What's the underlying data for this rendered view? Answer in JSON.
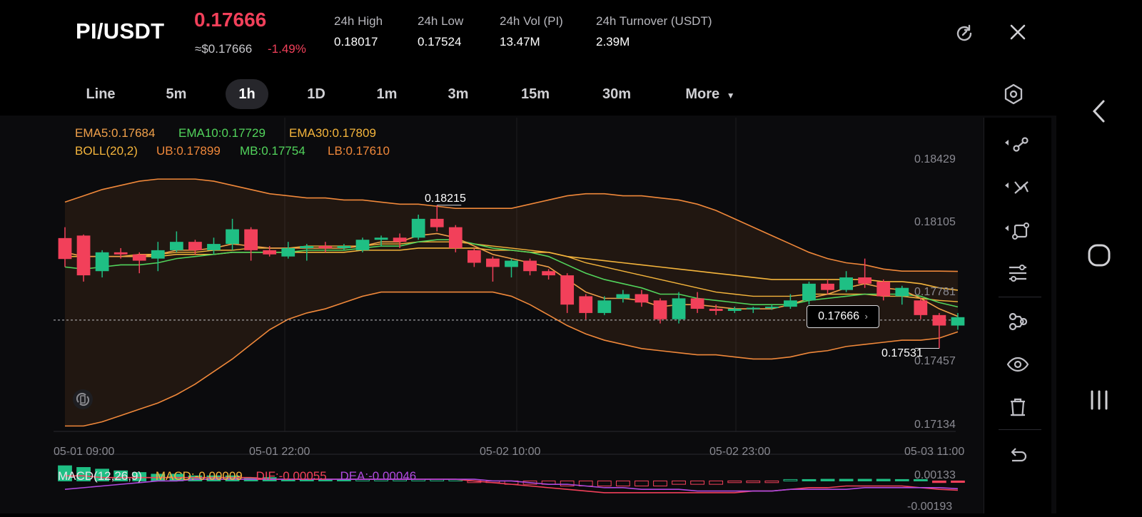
{
  "header": {
    "pair": "PI/USDT",
    "price": "0.17666",
    "approx": "≈$0.17666",
    "change": "-1.49%",
    "stats": [
      {
        "label": "24h   High",
        "value": "0.18017"
      },
      {
        "label": "24h   Low",
        "value": "0.17524"
      },
      {
        "label": "24h   Vol (PI)",
        "value": "13.47M"
      },
      {
        "label": "24h   Turnover (USDT)",
        "value": "2.39M"
      }
    ]
  },
  "tabs": [
    "Line",
    "5m",
    "1h",
    "1D",
    "1m",
    "3m",
    "15m",
    "30m",
    "More"
  ],
  "active_tab": "1h",
  "indicators": {
    "ema5": "EMA5:0.17684",
    "ema10": "EMA10:0.17729",
    "ema30": "EMA30:0.17809",
    "boll": "BOLL(20,2)",
    "ub": "UB:0.17899",
    "mb": "MB:0.17754",
    "lb": "LB:0.17610"
  },
  "price_axis": [
    "0.18429",
    "0.18105",
    "0.17781",
    "0.17457",
    "0.17134"
  ],
  "time_axis": [
    "05-01 09:00",
    "05-01 22:00",
    "05-02 10:00",
    "05-02 23:00",
    "05-03 11:00"
  ],
  "markers": {
    "high": "0.18215",
    "low": "0.17531",
    "current": "0.17666"
  },
  "macd": {
    "title": "MACD(12,26,9)",
    "macd": "MACD:-0.00009",
    "dif": "DIF:-0.00055",
    "dea": "DEA:-0.00046",
    "axis_top": "0.00133",
    "axis_bottom": "-0.00193"
  },
  "colors": {
    "up": "#1fbf84",
    "down": "#f2405a",
    "ema5": "#f0a04a",
    "ema10": "#52d45c",
    "ema30": "#f5b53c",
    "boll": "#f0883a",
    "dea": "#b04adf"
  },
  "chart_data": {
    "type": "candlestick",
    "ylim": [
      0.17134,
      0.18429
    ],
    "candles": [
      {
        "o": 0.18058,
        "c": 0.17958,
        "h": 0.1811,
        "l": 0.1792
      },
      {
        "o": 0.1807,
        "c": 0.1788,
        "h": 0.18075,
        "l": 0.1785
      },
      {
        "o": 0.179,
        "c": 0.1799,
        "h": 0.18,
        "l": 0.1787
      },
      {
        "o": 0.1799,
        "c": 0.1798,
        "h": 0.1801,
        "l": 0.1796
      },
      {
        "o": 0.1798,
        "c": 0.1795,
        "h": 0.1799,
        "l": 0.1789
      },
      {
        "o": 0.1796,
        "c": 0.18,
        "h": 0.1804,
        "l": 0.179
      },
      {
        "o": 0.18,
        "c": 0.1804,
        "h": 0.1809,
        "l": 0.1799
      },
      {
        "o": 0.1804,
        "c": 0.18,
        "h": 0.1805,
        "l": 0.1798
      },
      {
        "o": 0.18,
        "c": 0.1803,
        "h": 0.1806,
        "l": 0.1798
      },
      {
        "o": 0.1803,
        "c": 0.181,
        "h": 0.1815,
        "l": 0.18
      },
      {
        "o": 0.181,
        "c": 0.18,
        "h": 0.1811,
        "l": 0.1795
      },
      {
        "o": 0.18,
        "c": 0.1798,
        "h": 0.1802,
        "l": 0.1797
      },
      {
        "o": 0.1797,
        "c": 0.1801,
        "h": 0.1804,
        "l": 0.1796
      },
      {
        "o": 0.1801,
        "c": 0.1802,
        "h": 0.1803,
        "l": 0.1795
      },
      {
        "o": 0.1802,
        "c": 0.1801,
        "h": 0.1804,
        "l": 0.1799
      },
      {
        "o": 0.1801,
        "c": 0.1802,
        "h": 0.1803,
        "l": 0.18
      },
      {
        "o": 0.18,
        "c": 0.1805,
        "h": 0.1806,
        "l": 0.1799
      },
      {
        "o": 0.1805,
        "c": 0.1806,
        "h": 0.1807,
        "l": 0.1802
      },
      {
        "o": 0.1806,
        "c": 0.1804,
        "h": 0.1808,
        "l": 0.1801
      },
      {
        "o": 0.1806,
        "c": 0.1815,
        "h": 0.1817,
        "l": 0.1805
      },
      {
        "o": 0.1815,
        "c": 0.1811,
        "h": 0.18215,
        "l": 0.1809
      },
      {
        "o": 0.1811,
        "c": 0.1801,
        "h": 0.1812,
        "l": 0.1799
      },
      {
        "o": 0.18,
        "c": 0.1794,
        "h": 0.1801,
        "l": 0.1792
      },
      {
        "o": 0.1796,
        "c": 0.1792,
        "h": 0.1797,
        "l": 0.1785
      },
      {
        "o": 0.1792,
        "c": 0.1795,
        "h": 0.1796,
        "l": 0.1787
      },
      {
        "o": 0.1795,
        "c": 0.179,
        "h": 0.1796,
        "l": 0.1788
      },
      {
        "o": 0.179,
        "c": 0.1788,
        "h": 0.1791,
        "l": 0.1786
      },
      {
        "o": 0.1788,
        "c": 0.1774,
        "h": 0.1789,
        "l": 0.177
      },
      {
        "o": 0.1778,
        "c": 0.177,
        "h": 0.1779,
        "l": 0.1767
      },
      {
        "o": 0.177,
        "c": 0.1776,
        "h": 0.1778,
        "l": 0.1769
      },
      {
        "o": 0.1777,
        "c": 0.1779,
        "h": 0.1781,
        "l": 0.1775
      },
      {
        "o": 0.1779,
        "c": 0.1775,
        "h": 0.1781,
        "l": 0.1773
      },
      {
        "o": 0.1776,
        "c": 0.1767,
        "h": 0.1777,
        "l": 0.1765
      },
      {
        "o": 0.1767,
        "c": 0.1777,
        "h": 0.178,
        "l": 0.1765
      },
      {
        "o": 0.1777,
        "c": 0.1772,
        "h": 0.178,
        "l": 0.177
      },
      {
        "o": 0.1772,
        "c": 0.1771,
        "h": 0.1774,
        "l": 0.1769
      },
      {
        "o": 0.1771,
        "c": 0.1772,
        "h": 0.1773,
        "l": 0.177
      },
      {
        "o": 0.1772,
        "c": 0.17725,
        "h": 0.1773,
        "l": 0.177
      },
      {
        "o": 0.17725,
        "c": 0.1773,
        "h": 0.1774,
        "l": 0.17715
      },
      {
        "o": 0.1773,
        "c": 0.1776,
        "h": 0.1779,
        "l": 0.1772
      },
      {
        "o": 0.1776,
        "c": 0.1784,
        "h": 0.1785,
        "l": 0.1774
      },
      {
        "o": 0.1784,
        "c": 0.1781,
        "h": 0.1786,
        "l": 0.1779
      },
      {
        "o": 0.1781,
        "c": 0.1787,
        "h": 0.179,
        "l": 0.178
      },
      {
        "o": 0.1787,
        "c": 0.1784,
        "h": 0.1796,
        "l": 0.1782
      },
      {
        "o": 0.1785,
        "c": 0.1778,
        "h": 0.1786,
        "l": 0.1776
      },
      {
        "o": 0.1778,
        "c": 0.1782,
        "h": 0.1783,
        "l": 0.1774
      },
      {
        "o": 0.1776,
        "c": 0.1769,
        "h": 0.1777,
        "l": 0.1767
      },
      {
        "o": 0.1769,
        "c": 0.1764,
        "h": 0.177,
        "l": 0.17531
      },
      {
        "o": 0.1764,
        "c": 0.1768,
        "h": 0.177,
        "l": 0.1762
      }
    ],
    "ema5": [
      0.1799,
      0.1797,
      0.1797,
      0.1797,
      0.1797,
      0.1798,
      0.18,
      0.18,
      0.1801,
      0.1803,
      0.1802,
      0.1801,
      0.1801,
      0.1801,
      0.1801,
      0.1801,
      0.1802,
      0.1804,
      0.1804,
      0.1807,
      0.1808,
      0.1806,
      0.1802,
      0.1798,
      0.1796,
      0.1794,
      0.1792,
      0.1786,
      0.178,
      0.1777,
      0.1777,
      0.1776,
      0.1773,
      0.1774,
      0.1774,
      0.1773,
      0.1772,
      0.1772,
      0.1772,
      0.1774,
      0.1777,
      0.1779,
      0.1782,
      0.1784,
      0.1782,
      0.1781,
      0.1777,
      0.1772,
      0.17684
    ],
    "ema10": [
      0.1792,
      0.1791,
      0.1792,
      0.1793,
      0.1793,
      0.1794,
      0.1796,
      0.1797,
      0.1798,
      0.1799,
      0.1799,
      0.1799,
      0.1799,
      0.18,
      0.18,
      0.18,
      0.1801,
      0.1802,
      0.1802,
      0.1804,
      0.1805,
      0.1805,
      0.1803,
      0.1801,
      0.18,
      0.1799,
      0.1797,
      0.1793,
      0.1789,
      0.1786,
      0.1784,
      0.1782,
      0.1779,
      0.1779,
      0.1777,
      0.1776,
      0.1775,
      0.1774,
      0.1774,
      0.1774,
      0.1776,
      0.1777,
      0.1778,
      0.1779,
      0.1779,
      0.1779,
      0.1778,
      0.1775,
      0.17729
    ],
    "ema30": [
      0.1797,
      0.1797,
      0.1797,
      0.1797,
      0.1797,
      0.1797,
      0.1798,
      0.1798,
      0.1798,
      0.1799,
      0.1799,
      0.1799,
      0.1799,
      0.1799,
      0.1799,
      0.1799,
      0.18,
      0.18,
      0.18,
      0.1801,
      0.1801,
      0.1801,
      0.1801,
      0.18,
      0.18,
      0.1799,
      0.1799,
      0.1797,
      0.1796,
      0.1795,
      0.1794,
      0.1793,
      0.1792,
      0.1791,
      0.179,
      0.1789,
      0.1788,
      0.1787,
      0.1786,
      0.1786,
      0.1786,
      0.1786,
      0.1786,
      0.1786,
      0.1785,
      0.1785,
      0.1784,
      0.1782,
      0.17809
    ],
    "boll_ub": [
      0.1823,
      0.1826,
      0.1829,
      0.1831,
      0.1833,
      0.1834,
      0.1834,
      0.1834,
      0.1833,
      0.1831,
      0.1829,
      0.1827,
      0.1826,
      0.1825,
      0.1825,
      0.1824,
      0.1824,
      0.1823,
      0.1822,
      0.1822,
      0.1821,
      0.182,
      0.182,
      0.182,
      0.182,
      0.1822,
      0.1824,
      0.1826,
      0.1827,
      0.1827,
      0.1826,
      0.1826,
      0.1825,
      0.1824,
      0.1822,
      0.1819,
      0.1815,
      0.1811,
      0.1807,
      0.1803,
      0.1799,
      0.1796,
      0.1794,
      0.1793,
      0.1791,
      0.179,
      0.179,
      0.179,
      0.17899
    ],
    "boll_mb": [
      0.1797,
      0.1797,
      0.1797,
      0.1797,
      0.1798,
      0.1798,
      0.1799,
      0.1799,
      0.18,
      0.18,
      0.1801,
      0.1801,
      0.1801,
      0.1802,
      0.1802,
      0.1802,
      0.1802,
      0.1803,
      0.1803,
      0.1804,
      0.1804,
      0.1804,
      0.1803,
      0.1802,
      0.1801,
      0.18,
      0.1799,
      0.1797,
      0.1794,
      0.1792,
      0.179,
      0.1788,
      0.1786,
      0.1784,
      0.1782,
      0.178,
      0.1779,
      0.1778,
      0.1778,
      0.1778,
      0.1779,
      0.1779,
      0.1779,
      0.1779,
      0.1778,
      0.1778,
      0.1777,
      0.1776,
      0.17754
    ],
    "boll_lb": [
      0.1716,
      0.1716,
      0.1718,
      0.1721,
      0.1724,
      0.1727,
      0.1731,
      0.1736,
      0.1742,
      0.1748,
      0.1755,
      0.1762,
      0.1767,
      0.177,
      0.1772,
      0.1775,
      0.1778,
      0.178,
      0.178,
      0.178,
      0.178,
      0.178,
      0.178,
      0.178,
      0.1778,
      0.1774,
      0.1769,
      0.1764,
      0.176,
      0.1757,
      0.1755,
      0.1753,
      0.1752,
      0.1751,
      0.175,
      0.175,
      0.1749,
      0.1748,
      0.1748,
      0.1749,
      0.1751,
      0.1752,
      0.1754,
      0.1755,
      0.1756,
      0.1757,
      0.1757,
      0.1758,
      0.1761
    ],
    "macd_hist": [
      0.0009,
      0.0008,
      0.0007,
      0.0006,
      0.0005,
      0.0004,
      0.0004,
      0.0003,
      0.0003,
      0.0003,
      0.0002,
      0.0002,
      0.0001,
      0.0001,
      0.0001,
      0.0001,
      0.0001,
      0.0001,
      0.0001,
      0.0001,
      0.0001,
      0.0,
      -0.0001,
      -0.0001,
      -0.0002,
      -0.0002,
      -0.0002,
      -0.0003,
      -0.0003,
      -0.0003,
      -0.0003,
      -0.0003,
      -0.0003,
      -0.0002,
      -0.0002,
      -0.0002,
      -0.0001,
      -0.0001,
      -0.0001,
      0.0,
      0.0,
      0.0001,
      0.0001,
      0.0001,
      0.0001,
      0.0,
      0.0,
      -0.0001,
      -9e-05
    ],
    "macd_dif": [
      0.0003,
      0.0003,
      0.0002,
      0.0002,
      0.0002,
      0.0002,
      0.0002,
      0.0002,
      0.0002,
      0.0002,
      0.0002,
      0.0001,
      0.0001,
      0.0001,
      0.0001,
      0.0001,
      0.0001,
      0.0001,
      0.0001,
      0.0001,
      0.0001,
      0.0001,
      0.0,
      -0.0001,
      -0.0002,
      -0.0003,
      -0.0004,
      -0.0005,
      -0.0006,
      -0.0007,
      -0.0007,
      -0.0007,
      -0.0007,
      -0.0007,
      -0.0007,
      -0.0007,
      -0.0007,
      -0.0006,
      -0.0006,
      -0.0005,
      -0.0004,
      -0.0004,
      -0.0003,
      -0.0003,
      -0.0003,
      -0.0003,
      -0.0004,
      -0.0005,
      -0.00055
    ],
    "macd_dea": [
      -0.0005,
      -0.0004,
      -0.0003,
      -0.0002,
      -0.0001,
      0.0,
      0.0,
      0.0001,
      0.0001,
      0.0001,
      0.0001,
      0.0001,
      0.0001,
      0.0001,
      0.0001,
      0.0001,
      0.0001,
      0.0001,
      0.0001,
      0.0001,
      0.0001,
      0.0001,
      0.0001,
      0.0,
      0.0,
      -0.0001,
      -0.0002,
      -0.0002,
      -0.0003,
      -0.0004,
      -0.0004,
      -0.0005,
      -0.0005,
      -0.0005,
      -0.0006,
      -0.0006,
      -0.0006,
      -0.0006,
      -0.0006,
      -0.0005,
      -0.0005,
      -0.0005,
      -0.0005,
      -0.0004,
      -0.0004,
      -0.0004,
      -0.0004,
      -0.0004,
      -0.00046
    ]
  }
}
